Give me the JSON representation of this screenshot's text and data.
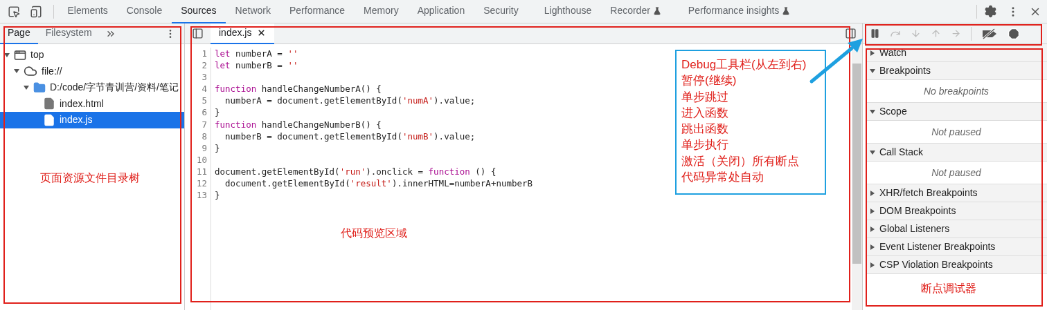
{
  "toolbar": {
    "tabs": [
      {
        "label": "Elements",
        "selected": false,
        "experimental": false
      },
      {
        "label": "Console",
        "selected": false,
        "experimental": false
      },
      {
        "label": "Sources",
        "selected": true,
        "experimental": false
      },
      {
        "label": "Network",
        "selected": false,
        "experimental": false
      },
      {
        "label": "Performance",
        "selected": false,
        "experimental": false
      },
      {
        "label": "Memory",
        "selected": false,
        "experimental": false
      },
      {
        "label": "Application",
        "selected": false,
        "experimental": false
      },
      {
        "label": "Security",
        "selected": false,
        "experimental": false
      },
      {
        "label": "Lighthouse",
        "selected": false,
        "experimental": false
      },
      {
        "label": "Recorder",
        "selected": false,
        "experimental": true
      },
      {
        "label": "Performance insights",
        "selected": false,
        "experimental": true
      }
    ]
  },
  "navigator": {
    "tabs": [
      {
        "label": "Page",
        "selected": true
      },
      {
        "label": "Filesystem",
        "selected": false
      }
    ],
    "tree": [
      {
        "label": "top",
        "kind": "frame",
        "expanded": true,
        "selected": false,
        "children": [
          {
            "label": "file://",
            "kind": "cloud",
            "expanded": true,
            "selected": false,
            "children": [
              {
                "label": "D:/code/字节青训营/资料/笔记",
                "kind": "folder",
                "expanded": true,
                "selected": false,
                "children": [
                  {
                    "label": "index.html",
                    "kind": "page",
                    "selected": false
                  },
                  {
                    "label": "index.js",
                    "kind": "script",
                    "selected": true
                  }
                ]
              }
            ]
          }
        ]
      }
    ],
    "annotation": "页面资源文件目录树"
  },
  "editor": {
    "file_tab": {
      "label": "index.js",
      "selected": true
    },
    "lines": [
      {
        "number": "1",
        "tokens": [
          {
            "text": "let",
            "kind": "keyword"
          },
          {
            "text": " numberA = ",
            "kind": "plain"
          },
          {
            "text": "''",
            "kind": "string"
          }
        ]
      },
      {
        "number": "2",
        "tokens": [
          {
            "text": "let",
            "kind": "keyword"
          },
          {
            "text": " numberB = ",
            "kind": "plain"
          },
          {
            "text": "''",
            "kind": "string"
          }
        ]
      },
      {
        "number": "3"
      },
      {
        "number": "4",
        "tokens": [
          {
            "text": "function",
            "kind": "keyword"
          },
          {
            "text": " handleChangeNumberA() {",
            "kind": "plain"
          }
        ]
      },
      {
        "number": "5",
        "tokens": [
          {
            "text": "  numberA = document.getElementById(",
            "kind": "plain"
          },
          {
            "text": "'numA'",
            "kind": "string"
          },
          {
            "text": ").value;",
            "kind": "plain"
          }
        ]
      },
      {
        "number": "6",
        "tokens": [
          {
            "text": "}",
            "kind": "plain"
          }
        ]
      },
      {
        "number": "7",
        "tokens": [
          {
            "text": "function",
            "kind": "keyword"
          },
          {
            "text": " handleChangeNumberB() {",
            "kind": "plain"
          }
        ]
      },
      {
        "number": "8",
        "tokens": [
          {
            "text": "  numberB = document.getElementById(",
            "kind": "plain"
          },
          {
            "text": "'numB'",
            "kind": "string"
          },
          {
            "text": ").value;",
            "kind": "plain"
          }
        ]
      },
      {
        "number": "9",
        "tokens": [
          {
            "text": "}",
            "kind": "plain"
          }
        ]
      },
      {
        "number": "10"
      },
      {
        "number": "11",
        "tokens": [
          {
            "text": "document.getElementById(",
            "kind": "plain"
          },
          {
            "text": "'run'",
            "kind": "string"
          },
          {
            "text": ").onclick = ",
            "kind": "plain"
          },
          {
            "text": "function",
            "kind": "keyword"
          },
          {
            "text": " () {",
            "kind": "plain"
          }
        ]
      },
      {
        "number": "12",
        "tokens": [
          {
            "text": "  document.getElementById(",
            "kind": "plain"
          },
          {
            "text": "'result'",
            "kind": "string"
          },
          {
            "text": ").innerHTML=numberA+numberB",
            "kind": "plain"
          }
        ]
      },
      {
        "number": "13",
        "tokens": [
          {
            "text": "}",
            "kind": "plain"
          }
        ]
      }
    ],
    "annotation": "代码预览区域"
  },
  "callout": {
    "lines": [
      "Debug工具栏(从左到右)",
      "暂停(继续)",
      "单步跳过",
      "进入函数",
      "跳出函数",
      "单步执行",
      "激活（关闭）所有断点",
      "代码异常处自动"
    ]
  },
  "debugger": {
    "buttons": [
      {
        "kind": "pause",
        "disabled": false
      },
      {
        "kind": "step-over",
        "disabled": true
      },
      {
        "kind": "step-into",
        "disabled": true
      },
      {
        "kind": "step-out",
        "disabled": true
      },
      {
        "kind": "step",
        "disabled": true
      },
      {
        "kind": "deactivate",
        "disabled": false
      },
      {
        "kind": "pause-exceptions",
        "disabled": false
      }
    ],
    "sections": [
      {
        "title": "Watch",
        "expanded": false
      },
      {
        "title": "Breakpoints",
        "expanded": true,
        "message": "No breakpoints"
      },
      {
        "title": "Scope",
        "expanded": true,
        "message": "Not paused"
      },
      {
        "title": "Call Stack",
        "expanded": true,
        "message": "Not paused"
      },
      {
        "title": "XHR/fetch Breakpoints",
        "expanded": false
      },
      {
        "title": "DOM Breakpoints",
        "expanded": false
      },
      {
        "title": "Global Listeners",
        "expanded": false
      },
      {
        "title": "Event Listener Breakpoints",
        "expanded": false
      },
      {
        "title": "CSP Violation Breakpoints",
        "expanded": false
      }
    ],
    "annotation": "断点调试器"
  }
}
